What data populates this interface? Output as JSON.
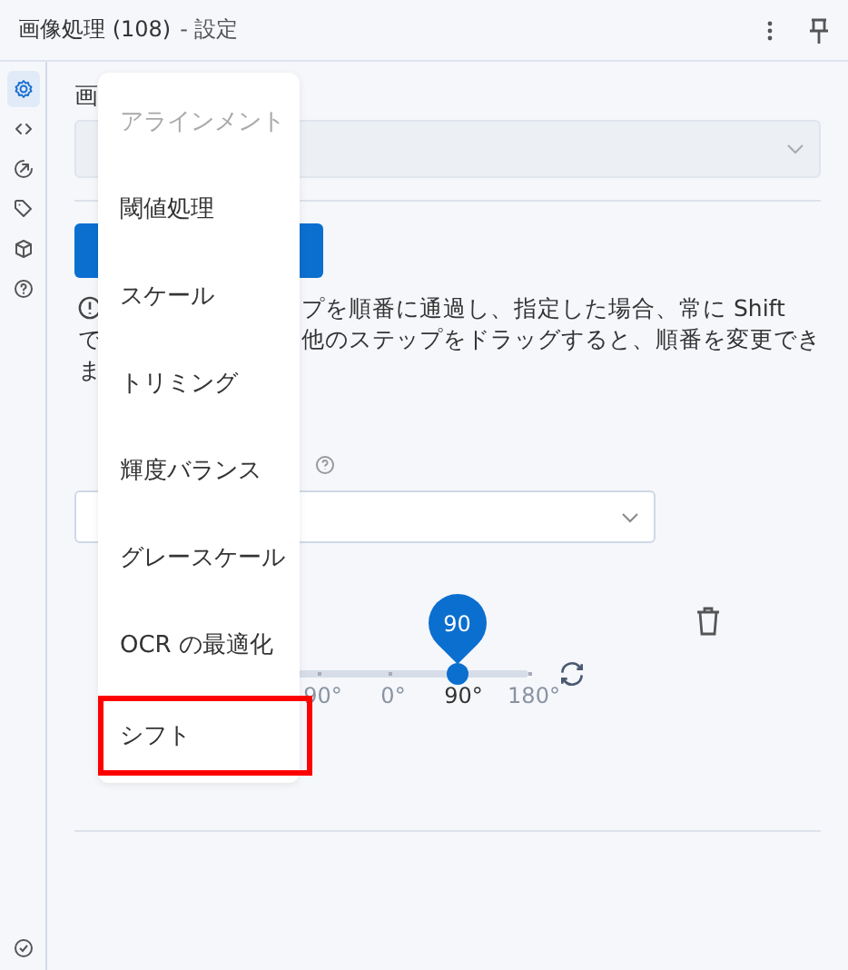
{
  "header": {
    "title": "画像処理 (108)",
    "subtitle": "- 設定"
  },
  "sidebar": {
    "items": [
      {
        "selected": true
      },
      {
        "selected": false
      },
      {
        "selected": false
      },
      {
        "selected": false
      },
      {
        "selected": false
      },
      {
        "selected": false
      }
    ]
  },
  "form": {
    "label_fragment": "画",
    "select_disabled": true,
    "info_lines": [
      {
        "text": "プを順番に通過し、指定した場合、常に Shift"
      },
      {
        "lead": "で",
        "text": "他のステップをドラッグすると、順番を変更でき"
      },
      {
        "lead": "ま"
      }
    ],
    "rotation": {
      "bubble": "90",
      "level": 0.75,
      "ticks": [
        {
          "label": "90°",
          "selected": false
        },
        {
          "label": "0°",
          "selected": false
        },
        {
          "label": "90°",
          "selected": true
        },
        {
          "label": "180°",
          "selected": false
        }
      ]
    }
  },
  "menu": {
    "items": [
      {
        "label": "アラインメント",
        "disabled": true,
        "selected": false
      },
      {
        "label": "閾値処理",
        "disabled": false,
        "selected": false
      },
      {
        "label": "スケール",
        "disabled": false,
        "selected": false
      },
      {
        "label": "トリミング",
        "disabled": false,
        "selected": false
      },
      {
        "label": "輝度バランス",
        "disabled": false,
        "selected": false
      },
      {
        "label": "グレースケール",
        "disabled": false,
        "selected": false
      },
      {
        "label": "OCR の最適化",
        "disabled": false,
        "selected": false
      },
      {
        "label": "シフト",
        "disabled": false,
        "selected": true
      }
    ]
  }
}
